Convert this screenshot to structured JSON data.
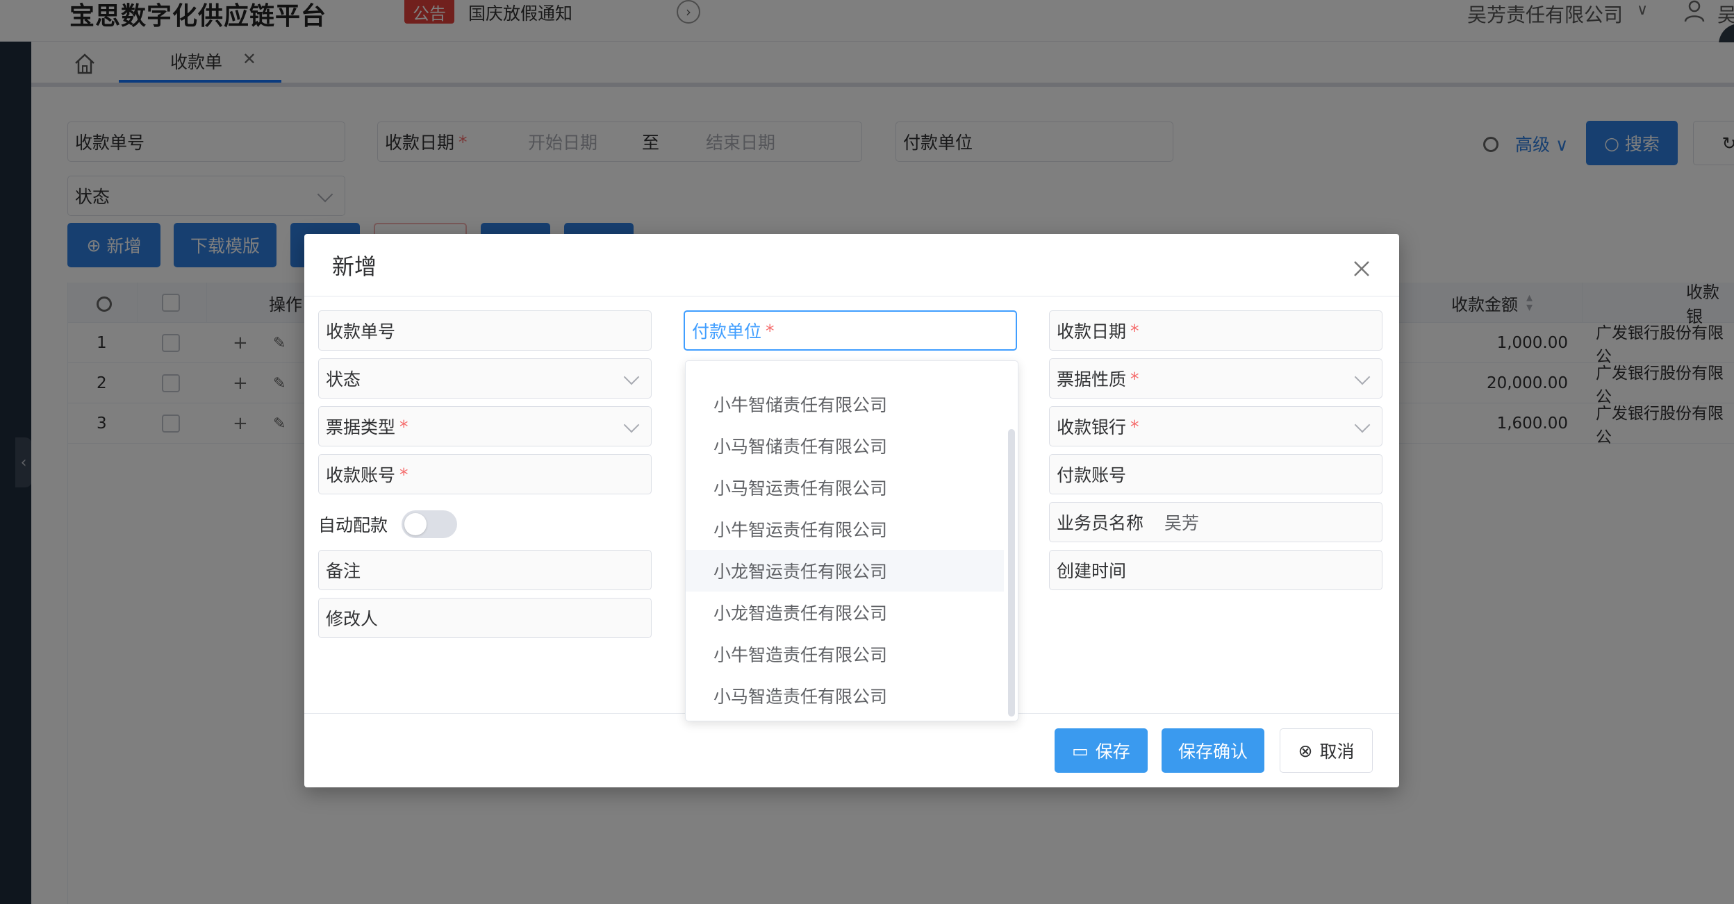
{
  "header": {
    "brand": "宝思数字化供应链平台",
    "notice_badge": "公告",
    "notice_text": "国庆放假通知",
    "company": "吴芳责任有限公司",
    "user_trunc": "吴"
  },
  "tabs": [
    {
      "label": "收款单"
    }
  ],
  "filters": {
    "receipt_no": "收款单号",
    "receipt_date": "收款日期",
    "start_placeholder": "开始日期",
    "range_sep": "至",
    "end_placeholder": "结束日期",
    "payer": "付款单位",
    "status": "状态",
    "advanced": "高级",
    "search": "搜索"
  },
  "toolbar": {
    "add": "新增",
    "download_template": "下载模版"
  },
  "grid": {
    "op_header": "操作",
    "amount_header": "收款金额",
    "bank_header": "收款银",
    "rows": [
      {
        "no": "1",
        "amount": "1,000.00",
        "bank": "广发银行股份有限公"
      },
      {
        "no": "2",
        "amount": "20,000.00",
        "bank": "广发银行股份有限公"
      },
      {
        "no": "3",
        "amount": "1,600.00",
        "bank": "广发银行股份有限公"
      }
    ]
  },
  "dialog": {
    "title": "新增",
    "fields": {
      "receipt_no": "收款单号",
      "status": "状态",
      "bill_type": "票据类型",
      "account_no": "收款账号",
      "auto_match": "自动配款",
      "remark": "备注",
      "modifier": "修改人",
      "payer": "付款单位",
      "receipt_date": "收款日期",
      "bill_nature": "票据性质",
      "bank": "收款银行",
      "payer_account": "付款账号",
      "salesperson": "业务员名称",
      "salesperson_value": "吴芳",
      "created_time": "创建时间"
    },
    "auto_match_on": false,
    "payer_options": [
      "小牛智储责任有限公司",
      "小马智储责任有限公司",
      "小马智运责任有限公司",
      "小牛智运责任有限公司",
      "小龙智运责任有限公司",
      "小龙智造责任有限公司",
      "小牛智造责任有限公司",
      "小马智造责任有限公司"
    ],
    "hovered_option": "小龙智运责任有限公司",
    "buttons": {
      "save": "保存",
      "save_confirm": "保存确认",
      "cancel": "取消"
    }
  },
  "colors": {
    "primary": "#2e7fe0",
    "focus": "#409eff",
    "required": "#f56c6c",
    "notice": "#e2403a"
  }
}
